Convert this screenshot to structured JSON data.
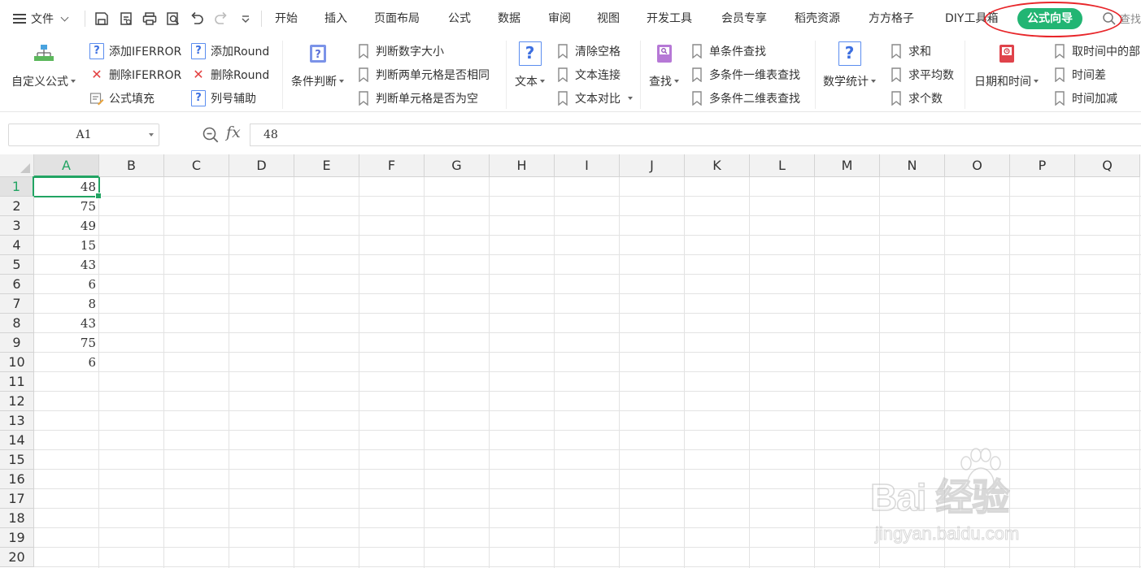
{
  "menubar": {
    "file_label": "文件",
    "tabs": [
      "开始",
      "插入",
      "页面布局",
      "公式",
      "数据",
      "审阅",
      "视图",
      "开发工具",
      "会员专享",
      "稻壳资源",
      "方方格子",
      "DIY工具箱"
    ],
    "active_tab": "公式向导",
    "search_label": "查找"
  },
  "ribbon": {
    "custom_formula": "自定义公式",
    "add_iferror": "添加IFERROR",
    "del_iferror": "删除IFERROR",
    "formula_fill": "公式填充",
    "add_round": "添加Round",
    "del_round": "删除Round",
    "col_helper": "列号辅助",
    "cond_judge": "条件判断",
    "judge_num_size": "判断数字大小",
    "judge_two_same": "判断两单元格是否相同",
    "judge_empty": "判断单元格是否为空",
    "text": "文本",
    "clear_space": "清除空格",
    "text_concat": "文本连接",
    "text_compare": "文本对比",
    "lookup": "查找",
    "single_lookup": "单条件查找",
    "multi_1d_lookup": "多条件一维表查找",
    "multi_2d_lookup": "多条件二维表查找",
    "math_stats": "数学统计",
    "sum": "求和",
    "average": "求平均数",
    "count": "求个数",
    "datetime": "日期和时间",
    "time_part": "取时间中的部",
    "time_diff": "时间差",
    "time_add": "时间加减"
  },
  "formula_bar": {
    "name_box": "A1",
    "fx_label": "fx",
    "formula": "48"
  },
  "sheet": {
    "columns": [
      "A",
      "B",
      "C",
      "D",
      "E",
      "F",
      "G",
      "H",
      "I",
      "J",
      "K",
      "L",
      "M",
      "N",
      "O",
      "P",
      "Q"
    ],
    "rows": [
      "1",
      "2",
      "3",
      "4",
      "5",
      "6",
      "7",
      "8",
      "9",
      "10",
      "11",
      "12",
      "13",
      "14",
      "15",
      "16",
      "17",
      "18",
      "19",
      "20"
    ],
    "col_a_values": [
      "48",
      "75",
      "49",
      "15",
      "43",
      "6",
      "8",
      "43",
      "75",
      "6"
    ],
    "selected_cell": "A1"
  },
  "watermark": {
    "logo_text": "Bai 经验",
    "url": "jingyan.baidu.com"
  },
  "colors": {
    "accent_green": "#22b573",
    "selection_green": "#22a463",
    "highlight_red": "#e8262a"
  }
}
